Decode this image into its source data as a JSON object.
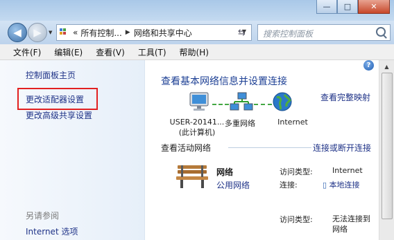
{
  "title_bar": {
    "minimize_glyph": "—",
    "maximize_glyph": "□",
    "close_glyph": "✕"
  },
  "nav": {
    "back_glyph": "◀",
    "forward_glyph": "▶",
    "breadcrumb": [
      "所有控制...",
      "网络和共享中心"
    ],
    "breadcrumb_overflow": "«",
    "search_placeholder": "搜索控制面板"
  },
  "menu": [
    "文件(F)",
    "编辑(E)",
    "查看(V)",
    "工具(T)",
    "帮助(H)"
  ],
  "sidebar": {
    "links": [
      "控制面板主页",
      "更改适配器设置",
      "更改高级共享设置"
    ],
    "see_also_heading": "另请参阅",
    "see_also_links": [
      "Internet 选项"
    ]
  },
  "main": {
    "help_glyph": "?",
    "title": "查看基本网络信息并设置连接",
    "full_map_link": "查看完整映射",
    "nodes": [
      {
        "line1": "USER-20141...",
        "line2": "(此计算机)"
      },
      {
        "line1": "多重网络",
        "line2": ""
      },
      {
        "line1": "Internet",
        "line2": ""
      }
    ],
    "active_networks_heading": "查看活动网络",
    "connect_disconnect_link": "连接或断开连接",
    "network": {
      "name": "网络",
      "type": "公用网络",
      "access_type_label": "访问类型:",
      "access_type_value": "Internet",
      "connection_label": "连接:",
      "connection_value": "本地连接"
    },
    "network2": {
      "access_type_label": "访问类型:",
      "access_type_value": "无法连接到网络"
    }
  },
  "colors": {
    "link": "#1e3287",
    "title": "#1c3f94",
    "highlight_box": "#e22020"
  },
  "icons": [
    "back-arrow-icon",
    "forward-arrow-icon",
    "control-panel-icon",
    "refresh-icon",
    "search-icon",
    "help-icon",
    "computer-icon",
    "network-icon",
    "globe-icon",
    "park-bench-icon",
    "network-adapter-icon"
  ]
}
